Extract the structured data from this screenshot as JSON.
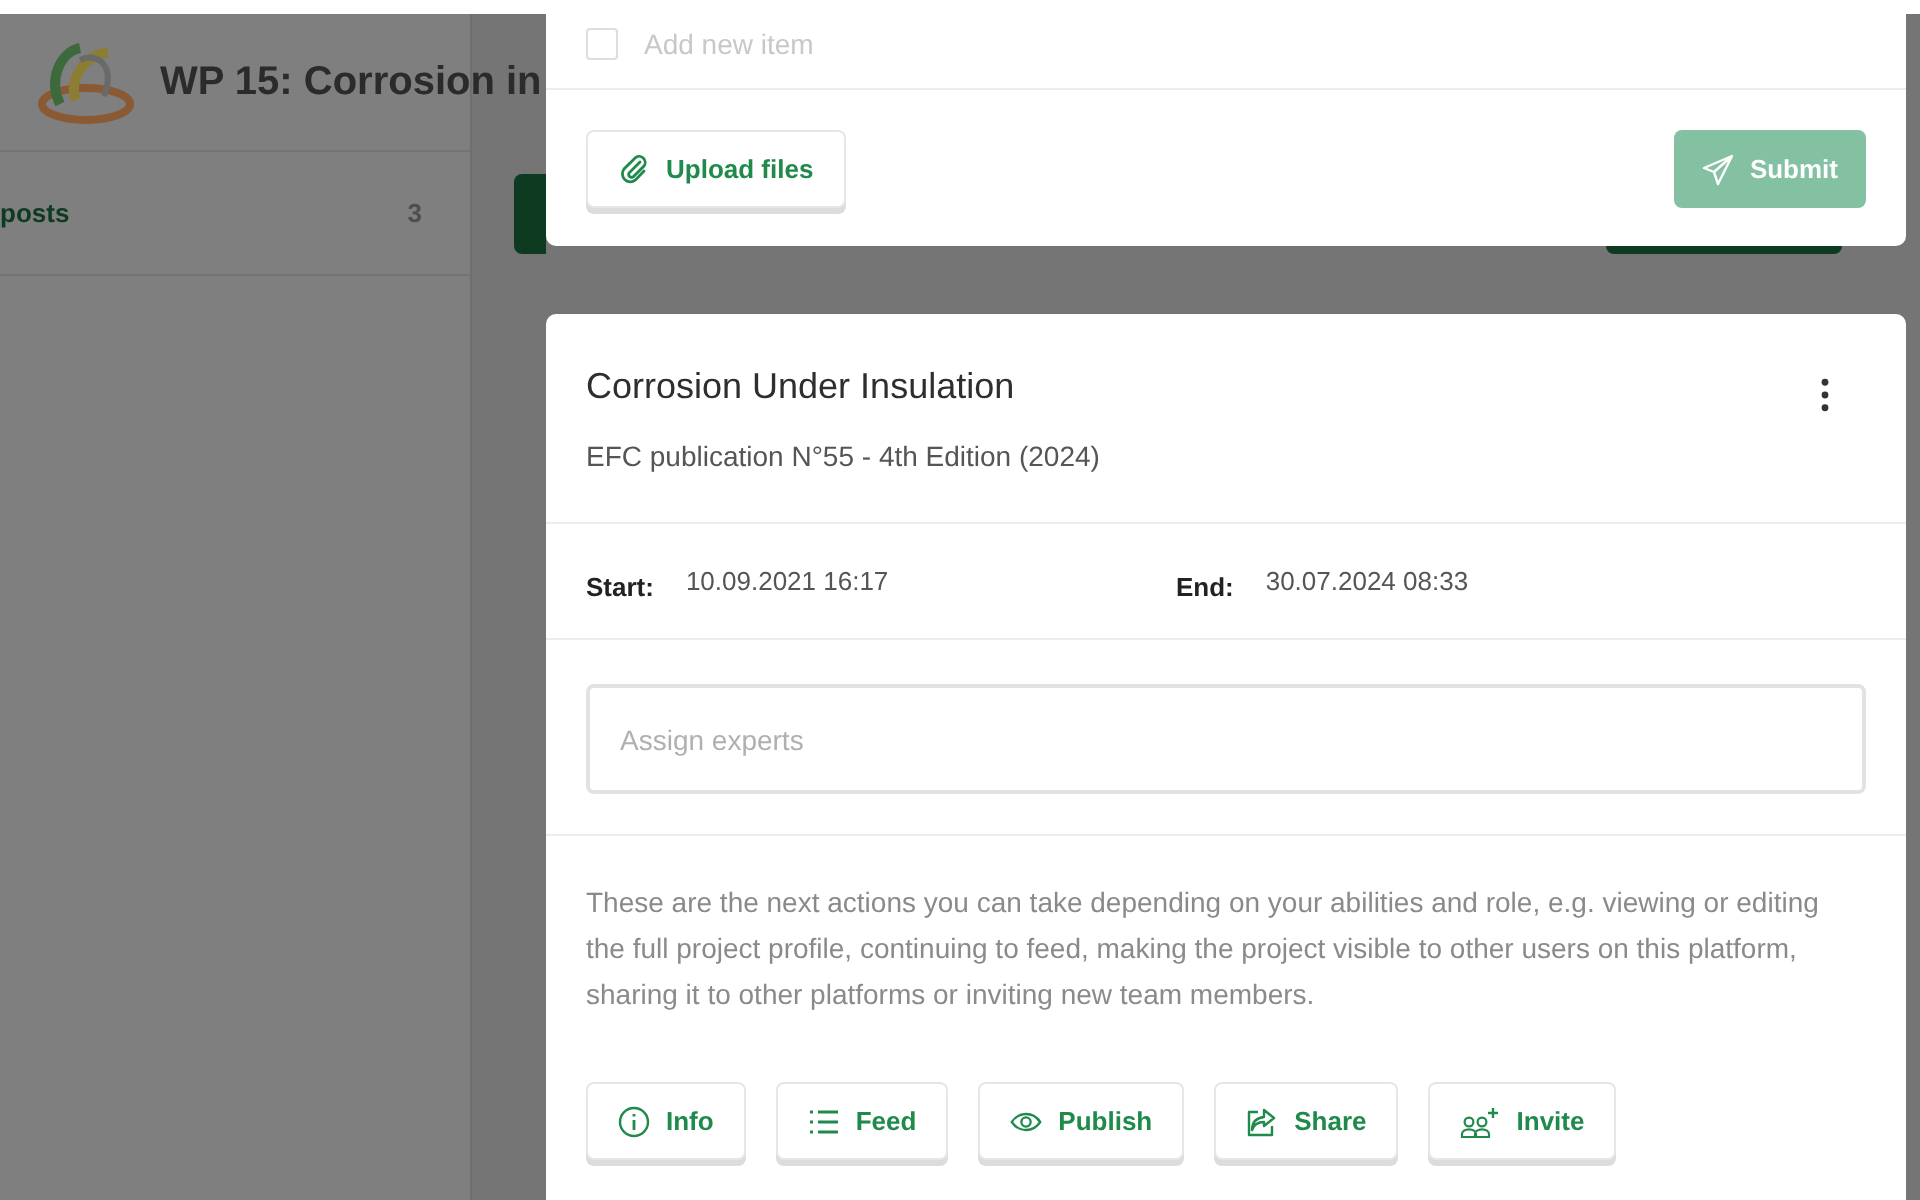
{
  "header": {
    "title": "WP 15: Corrosion in"
  },
  "sidebar": {
    "items": [
      {
        "label": "posts",
        "count": "3"
      }
    ]
  },
  "form_card": {
    "checklist": [
      {
        "label": "Add new item",
        "checked": false
      }
    ],
    "upload_button": "Upload files",
    "submit_button": {
      "label": "Submit",
      "disabled": true
    }
  },
  "project_card": {
    "title": "Corrosion Under Insulation",
    "subtitle": "EFC publication N°55 - 4th Edition (2024)",
    "start_label": "Start:",
    "start": "10.09.2021 16:17",
    "end_label": "End:",
    "end": "30.07.2024 08:33",
    "experts_field": {
      "placeholder": "Assign experts"
    },
    "description": "These are the next actions you can take depending on your abilities and role, e.g. viewing or editing the full project profile, continuing to feed, making the project visible to other users on this platform, sharing it to other platforms or inviting new team members.",
    "actions": [
      {
        "label": "Info",
        "kind": "info"
      },
      {
        "label": "Feed",
        "kind": "feed"
      },
      {
        "label": "Publish",
        "kind": "publish"
      },
      {
        "label": "Share",
        "kind": "share"
      },
      {
        "label": "Invite",
        "kind": "invite"
      }
    ]
  }
}
